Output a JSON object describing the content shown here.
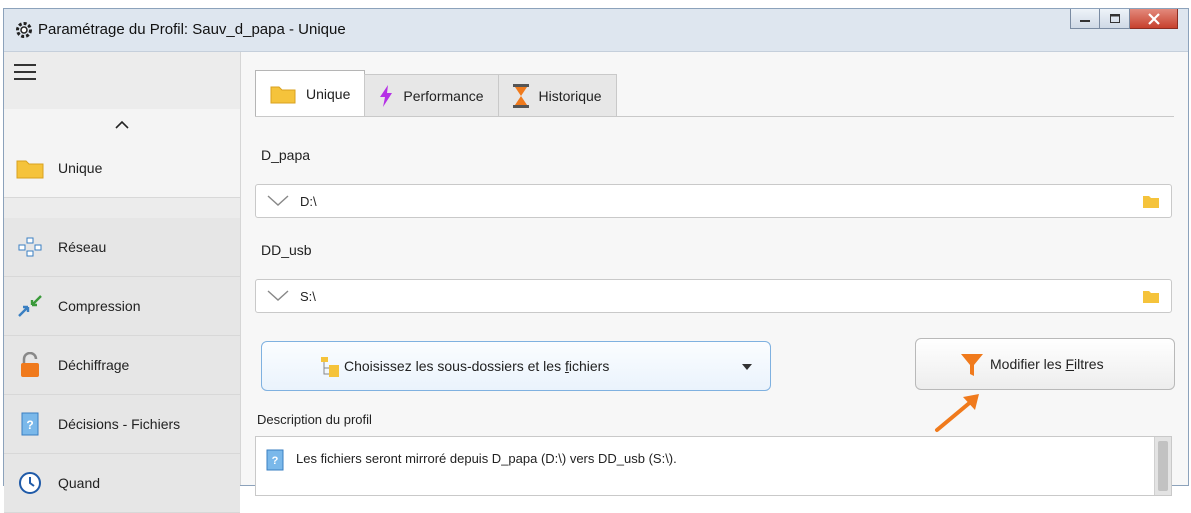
{
  "window": {
    "title": "Paramétrage du Profil: Sauv_d_papa - Unique",
    "app_icon": "gear-icon",
    "buttons": [
      "minimize-icon",
      "maximize-icon",
      "close-icon"
    ]
  },
  "sidebar": {
    "menu_icon": "hamburger-menu-icon",
    "collapse_icon": "chevron-up-icon",
    "items": [
      {
        "label": "Unique",
        "icon": "folder-icon"
      },
      {
        "label": "Réseau",
        "icon": "network-icon"
      },
      {
        "label": "Compression",
        "icon": "compress-icon"
      },
      {
        "label": "Déchiffrage",
        "icon": "unlock-icon"
      },
      {
        "label": "Décisions - Fichiers",
        "icon": "help-doc-icon"
      },
      {
        "label": "Quand",
        "icon": "clock-icon"
      }
    ]
  },
  "tabs": [
    {
      "label": "Unique",
      "icon": "folder-icon"
    },
    {
      "label": "Performance",
      "icon": "lightning-icon"
    },
    {
      "label": "Historique",
      "icon": "hourglass-icon"
    }
  ],
  "source": {
    "label": "D_papa",
    "path": "D:\\"
  },
  "destination": {
    "label": "DD_usb",
    "path": "S:\\"
  },
  "subfolders_button": {
    "label_pre": "Choisissez les sous-dossiers et les ",
    "label_ul": "f",
    "label_post": "ichiers"
  },
  "filters_button": {
    "label_pre": "Modifier les ",
    "label_ul": "F",
    "label_post": "iltres"
  },
  "description": {
    "label": "Description du profil",
    "text": "Les fichiers seront mirroré depuis D_papa (D:\\) vers DD_usb (S:\\)."
  },
  "colors": {
    "accent_orange": "#f07a1c",
    "folder_yellow": "#f5c33b",
    "lightning_purple": "#b531e6"
  }
}
